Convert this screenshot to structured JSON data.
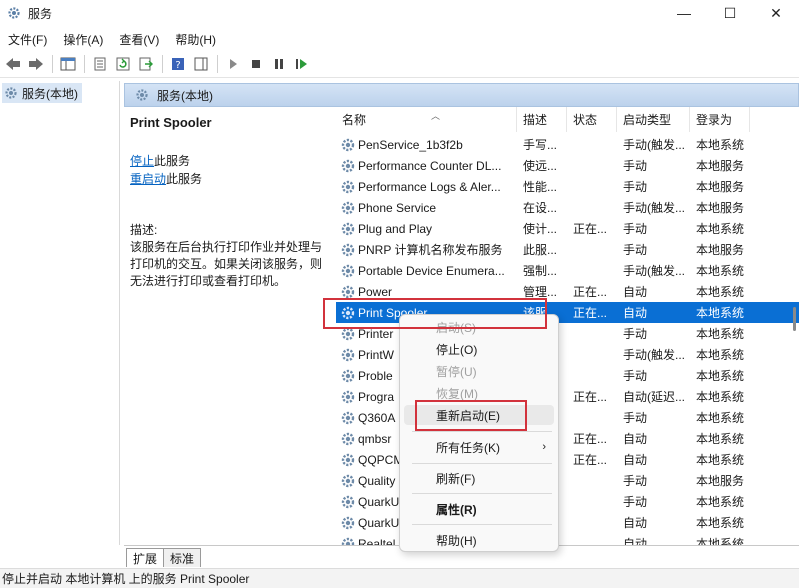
{
  "window": {
    "title": "服务",
    "minimize": "—",
    "maximize": "☐",
    "close": "✕"
  },
  "menu": [
    "文件(F)",
    "操作(A)",
    "查看(V)",
    "帮助(H)"
  ],
  "tree": {
    "root_label": "服务(本地)"
  },
  "pane": {
    "header": "服务(本地)"
  },
  "detail": {
    "title": "Print Spooler",
    "stop_link": "停止",
    "stop_suffix": "此服务",
    "restart_link": "重启动",
    "restart_suffix": "此服务",
    "desc_label": "描述:",
    "desc_text": "该服务在后台执行打印作业并处理与打印机的交互。如果关闭该服务，则无法进行打印或查看打印机。"
  },
  "columns": {
    "name": "名称",
    "desc": "描述",
    "status": "状态",
    "start": "启动类型",
    "logon": "登录为"
  },
  "rows": [
    {
      "name": "PenService_1b3f2b",
      "desc": "手写...",
      "status": "",
      "start": "手动(触发...",
      "logon": "本地系统"
    },
    {
      "name": "Performance Counter DL...",
      "desc": "使远...",
      "status": "",
      "start": "手动",
      "logon": "本地服务"
    },
    {
      "name": "Performance Logs & Aler...",
      "desc": "性能...",
      "status": "",
      "start": "手动",
      "logon": "本地服务"
    },
    {
      "name": "Phone Service",
      "desc": "在设...",
      "status": "",
      "start": "手动(触发...",
      "logon": "本地服务"
    },
    {
      "name": "Plug and Play",
      "desc": "使计...",
      "status": "正在...",
      "start": "手动",
      "logon": "本地系统"
    },
    {
      "name": "PNRP 计算机名称发布服务",
      "desc": "此服...",
      "status": "",
      "start": "手动",
      "logon": "本地服务"
    },
    {
      "name": "Portable Device Enumera...",
      "desc": "强制...",
      "status": "",
      "start": "手动(触发...",
      "logon": "本地系统"
    },
    {
      "name": "Power",
      "desc": "管理...",
      "status": "正在...",
      "start": "自动",
      "logon": "本地系统"
    },
    {
      "name": "Print Spooler",
      "desc": "该服...",
      "status": "正在...",
      "start": "自动",
      "logon": "本地系统",
      "selected": true
    },
    {
      "name": "Printer",
      "desc": "",
      "status": "",
      "start": "手动",
      "logon": "本地系统"
    },
    {
      "name": "PrintW",
      "desc": "",
      "status": "",
      "start": "手动(触发...",
      "logon": "本地系统"
    },
    {
      "name": "Proble",
      "desc": "",
      "status": "",
      "start": "手动",
      "logon": "本地系统"
    },
    {
      "name": "Progra",
      "desc": "",
      "status": "正在...",
      "start": "自动(延迟...",
      "logon": "本地系统"
    },
    {
      "name": "Q360A",
      "desc": "",
      "status": "",
      "start": "手动",
      "logon": "本地系统"
    },
    {
      "name": "qmbsr",
      "desc": "",
      "status": "正在...",
      "start": "自动",
      "logon": "本地系统"
    },
    {
      "name": "QQPCM",
      "desc": "",
      "status": "正在...",
      "start": "自动",
      "logon": "本地系统"
    },
    {
      "name": "Quality",
      "desc": "",
      "status": "",
      "start": "手动",
      "logon": "本地服务"
    },
    {
      "name": "QuarkU",
      "desc": "",
      "status": "",
      "start": "手动",
      "logon": "本地系统"
    },
    {
      "name": "QuarkU",
      "desc": "",
      "status": "",
      "start": "自动",
      "logon": "本地系统"
    },
    {
      "name": "Realtel",
      "desc": "",
      "status": "",
      "start": "自动",
      "logon": "本地系统"
    }
  ],
  "context_menu": {
    "start": "启动(S)",
    "stop": "停止(O)",
    "pause": "暂停(U)",
    "resume": "恢复(M)",
    "restart": "重新启动(E)",
    "all_tasks": "所有任务(K)",
    "refresh": "刷新(F)",
    "properties": "属性(R)",
    "help": "帮助(H)"
  },
  "tabs": [
    "扩展",
    "标准"
  ],
  "status_bar": "停止并启动 本地计算机 上的服务 Print Spooler",
  "colors": {
    "selection": "#0a6fd4",
    "highlight_box": "#d2323c",
    "link": "#0563c1"
  }
}
